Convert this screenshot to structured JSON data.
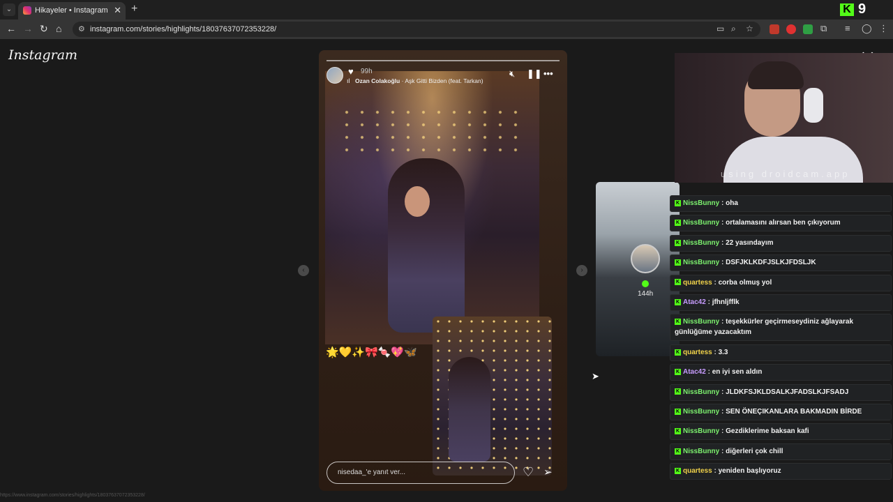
{
  "browser": {
    "tab_title": "Hikayeler • Instagram",
    "tab_close": "✕",
    "new_tab": "+",
    "url": "instagram.com/stories/highlights/18037637072353228/",
    "kick_badge": "K",
    "kick_count": "9"
  },
  "page": {
    "logo": "Instagram",
    "close": "✕",
    "status_url": "https://www.instagram.com/stories/highlights/18037637072353228/"
  },
  "story": {
    "time": "99h",
    "artist": "Ozan Colakoğlu",
    "song": " · Aşk Gitti Bizden (feat. Tarkan)",
    "emojis": "🌟💛✨🎀🍬💖🦋",
    "reply_placeholder": "nisedaa_'e yanıt ver..."
  },
  "side_story": {
    "time": "144h"
  },
  "webcam": {
    "watermark": "using droidcam.app"
  },
  "chat": {
    "colors": {
      "NissBunny": "#7cf06e",
      "quartess": "#f0d24a",
      "Atac42": "#c79cff"
    },
    "messages": [
      {
        "user": "NissBunny",
        "text": "oha"
      },
      {
        "user": "NissBunny",
        "text": "ortalamasını alırsan ben çıkıyorum"
      },
      {
        "user": "NissBunny",
        "text": "22 yasındayım"
      },
      {
        "user": "NissBunny",
        "text": "DSFJKLKDFJSLKJFDSLJK"
      },
      {
        "user": "quartess",
        "text": "corba olmuş yol"
      },
      {
        "user": "Atac42",
        "text": "jfhnljfflk"
      },
      {
        "user": "NissBunny",
        "text": "teşekkürler geçirmeseydiniz ağlayarak günlüğüme yazacaktım"
      },
      {
        "user": "quartess",
        "text": "3.3"
      },
      {
        "user": "Atac42",
        "text": "en iyi sen aldın"
      },
      {
        "user": "NissBunny",
        "text": "JLDKFSJKLDSALKJFADSLKJFSADJ"
      },
      {
        "user": "NissBunny",
        "text": "SEN ÖNEÇIKANLARA BAKMADIN BİRDE"
      },
      {
        "user": "NissBunny",
        "text": "Gezdiklerime baksan kafi"
      },
      {
        "user": "NissBunny",
        "text": "diğerleri çok chill"
      },
      {
        "user": "quartess",
        "text": "yeniden başlıyoruz"
      }
    ]
  }
}
